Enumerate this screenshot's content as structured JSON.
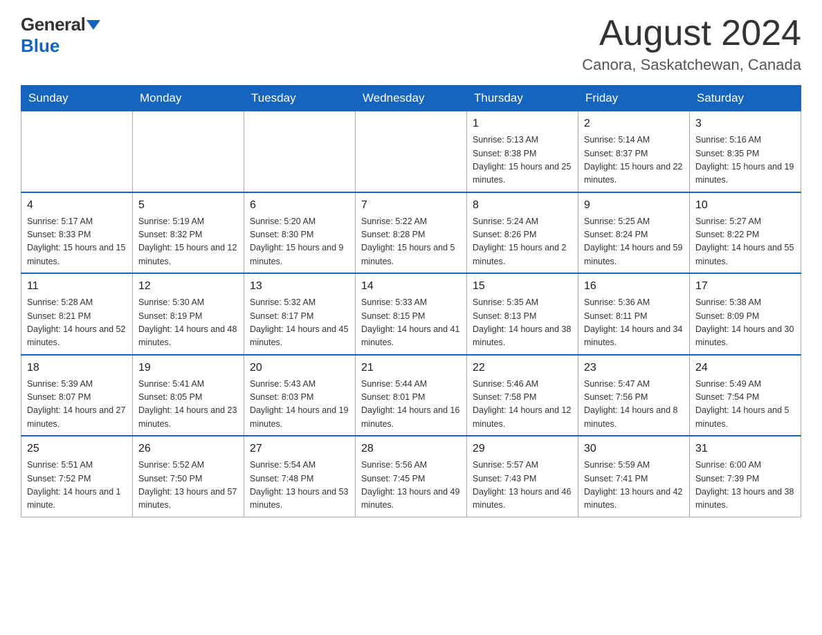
{
  "logo": {
    "general": "General",
    "blue": "Blue"
  },
  "title": "August 2024",
  "subtitle": "Canora, Saskatchewan, Canada",
  "days_of_week": [
    "Sunday",
    "Monday",
    "Tuesday",
    "Wednesday",
    "Thursday",
    "Friday",
    "Saturday"
  ],
  "weeks": [
    [
      {
        "day": "",
        "info": ""
      },
      {
        "day": "",
        "info": ""
      },
      {
        "day": "",
        "info": ""
      },
      {
        "day": "",
        "info": ""
      },
      {
        "day": "1",
        "info": "Sunrise: 5:13 AM\nSunset: 8:38 PM\nDaylight: 15 hours and 25 minutes."
      },
      {
        "day": "2",
        "info": "Sunrise: 5:14 AM\nSunset: 8:37 PM\nDaylight: 15 hours and 22 minutes."
      },
      {
        "day": "3",
        "info": "Sunrise: 5:16 AM\nSunset: 8:35 PM\nDaylight: 15 hours and 19 minutes."
      }
    ],
    [
      {
        "day": "4",
        "info": "Sunrise: 5:17 AM\nSunset: 8:33 PM\nDaylight: 15 hours and 15 minutes."
      },
      {
        "day": "5",
        "info": "Sunrise: 5:19 AM\nSunset: 8:32 PM\nDaylight: 15 hours and 12 minutes."
      },
      {
        "day": "6",
        "info": "Sunrise: 5:20 AM\nSunset: 8:30 PM\nDaylight: 15 hours and 9 minutes."
      },
      {
        "day": "7",
        "info": "Sunrise: 5:22 AM\nSunset: 8:28 PM\nDaylight: 15 hours and 5 minutes."
      },
      {
        "day": "8",
        "info": "Sunrise: 5:24 AM\nSunset: 8:26 PM\nDaylight: 15 hours and 2 minutes."
      },
      {
        "day": "9",
        "info": "Sunrise: 5:25 AM\nSunset: 8:24 PM\nDaylight: 14 hours and 59 minutes."
      },
      {
        "day": "10",
        "info": "Sunrise: 5:27 AM\nSunset: 8:22 PM\nDaylight: 14 hours and 55 minutes."
      }
    ],
    [
      {
        "day": "11",
        "info": "Sunrise: 5:28 AM\nSunset: 8:21 PM\nDaylight: 14 hours and 52 minutes."
      },
      {
        "day": "12",
        "info": "Sunrise: 5:30 AM\nSunset: 8:19 PM\nDaylight: 14 hours and 48 minutes."
      },
      {
        "day": "13",
        "info": "Sunrise: 5:32 AM\nSunset: 8:17 PM\nDaylight: 14 hours and 45 minutes."
      },
      {
        "day": "14",
        "info": "Sunrise: 5:33 AM\nSunset: 8:15 PM\nDaylight: 14 hours and 41 minutes."
      },
      {
        "day": "15",
        "info": "Sunrise: 5:35 AM\nSunset: 8:13 PM\nDaylight: 14 hours and 38 minutes."
      },
      {
        "day": "16",
        "info": "Sunrise: 5:36 AM\nSunset: 8:11 PM\nDaylight: 14 hours and 34 minutes."
      },
      {
        "day": "17",
        "info": "Sunrise: 5:38 AM\nSunset: 8:09 PM\nDaylight: 14 hours and 30 minutes."
      }
    ],
    [
      {
        "day": "18",
        "info": "Sunrise: 5:39 AM\nSunset: 8:07 PM\nDaylight: 14 hours and 27 minutes."
      },
      {
        "day": "19",
        "info": "Sunrise: 5:41 AM\nSunset: 8:05 PM\nDaylight: 14 hours and 23 minutes."
      },
      {
        "day": "20",
        "info": "Sunrise: 5:43 AM\nSunset: 8:03 PM\nDaylight: 14 hours and 19 minutes."
      },
      {
        "day": "21",
        "info": "Sunrise: 5:44 AM\nSunset: 8:01 PM\nDaylight: 14 hours and 16 minutes."
      },
      {
        "day": "22",
        "info": "Sunrise: 5:46 AM\nSunset: 7:58 PM\nDaylight: 14 hours and 12 minutes."
      },
      {
        "day": "23",
        "info": "Sunrise: 5:47 AM\nSunset: 7:56 PM\nDaylight: 14 hours and 8 minutes."
      },
      {
        "day": "24",
        "info": "Sunrise: 5:49 AM\nSunset: 7:54 PM\nDaylight: 14 hours and 5 minutes."
      }
    ],
    [
      {
        "day": "25",
        "info": "Sunrise: 5:51 AM\nSunset: 7:52 PM\nDaylight: 14 hours and 1 minute."
      },
      {
        "day": "26",
        "info": "Sunrise: 5:52 AM\nSunset: 7:50 PM\nDaylight: 13 hours and 57 minutes."
      },
      {
        "day": "27",
        "info": "Sunrise: 5:54 AM\nSunset: 7:48 PM\nDaylight: 13 hours and 53 minutes."
      },
      {
        "day": "28",
        "info": "Sunrise: 5:56 AM\nSunset: 7:45 PM\nDaylight: 13 hours and 49 minutes."
      },
      {
        "day": "29",
        "info": "Sunrise: 5:57 AM\nSunset: 7:43 PM\nDaylight: 13 hours and 46 minutes."
      },
      {
        "day": "30",
        "info": "Sunrise: 5:59 AM\nSunset: 7:41 PM\nDaylight: 13 hours and 42 minutes."
      },
      {
        "day": "31",
        "info": "Sunrise: 6:00 AM\nSunset: 7:39 PM\nDaylight: 13 hours and 38 minutes."
      }
    ]
  ]
}
